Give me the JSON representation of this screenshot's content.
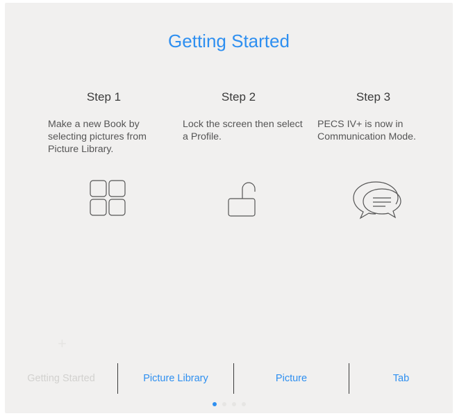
{
  "page": {
    "title": "Getting Started"
  },
  "steps": [
    {
      "title": "Step 1",
      "description": "Make a new Book by selecting pictures from Picture Library.",
      "icon": "grid-icon"
    },
    {
      "title": "Step 2",
      "description": "Lock the screen then select a Profile.",
      "icon": "unlock-icon"
    },
    {
      "title": "Step 3",
      "description": "PECS IV+ is now in Communication Mode.",
      "icon": "speech-bubbles-icon"
    }
  ],
  "tabs": [
    {
      "label": "Getting Started",
      "active": false
    },
    {
      "label": "Picture Library",
      "active": true
    },
    {
      "label": "Picture",
      "active": true
    },
    {
      "label": "Tab",
      "active": true
    }
  ],
  "add_icon": "+",
  "pager": {
    "total": 4,
    "current": 1
  },
  "colors": {
    "accent": "#2e8ff0",
    "background": "#f1f0ef",
    "inactive": "#d2d1cf"
  }
}
